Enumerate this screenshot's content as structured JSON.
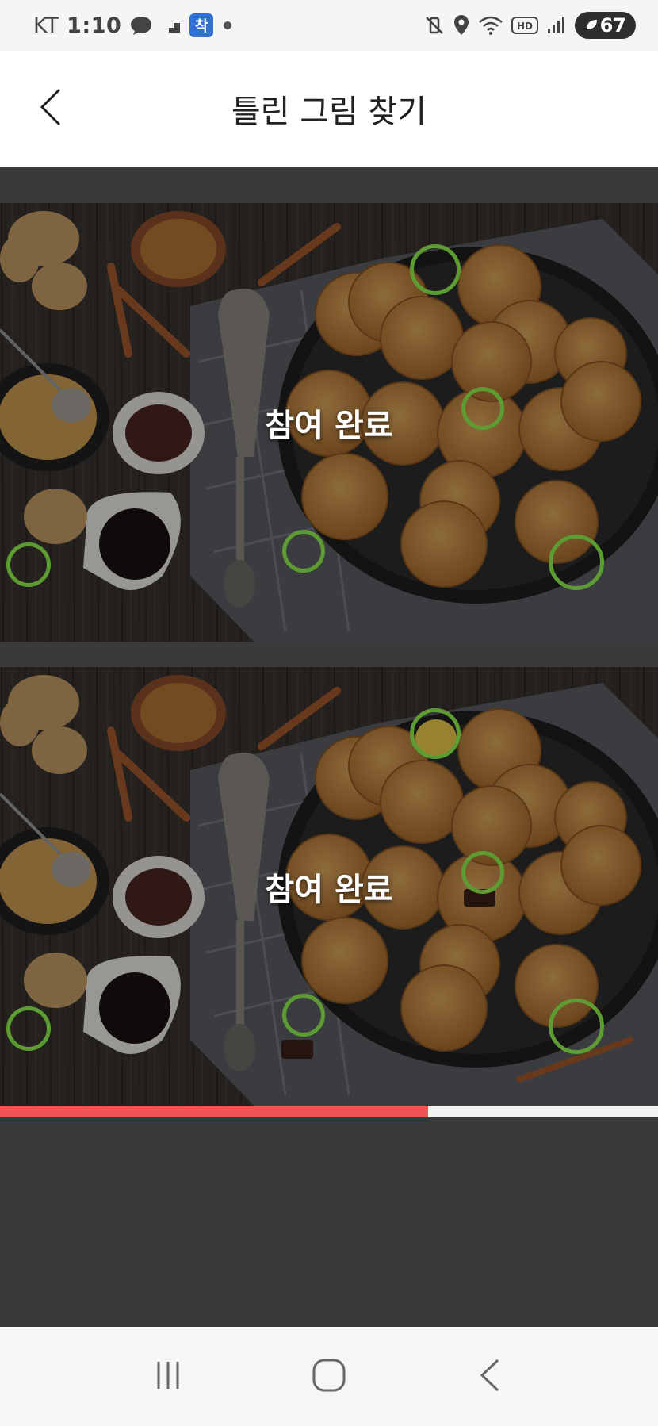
{
  "status_bar": {
    "carrier": "KT",
    "time": "1:10",
    "app_badge": "착",
    "battery": "67",
    "icons": [
      "chat-bubble-icon",
      "stairs-icon",
      "dot-icon",
      "mute-vibrate-icon",
      "location-icon",
      "wifi-icon",
      "hd-icon",
      "signal-icon",
      "battery-saver-icon"
    ]
  },
  "header": {
    "title": "틀린 그림 찾기",
    "back_icon": "chevron-left-icon"
  },
  "game": {
    "top_photo": {
      "overlay_text": "참여 완료"
    },
    "bottom_photo": {
      "overlay_text": "참여 완료"
    },
    "found_marker_color": "#5d9b33",
    "found_count": 5,
    "progress": 0.65,
    "progress_color": "#f05454"
  },
  "nav_bar": {
    "icons": [
      "recent-apps-icon",
      "home-icon",
      "back-icon"
    ]
  }
}
